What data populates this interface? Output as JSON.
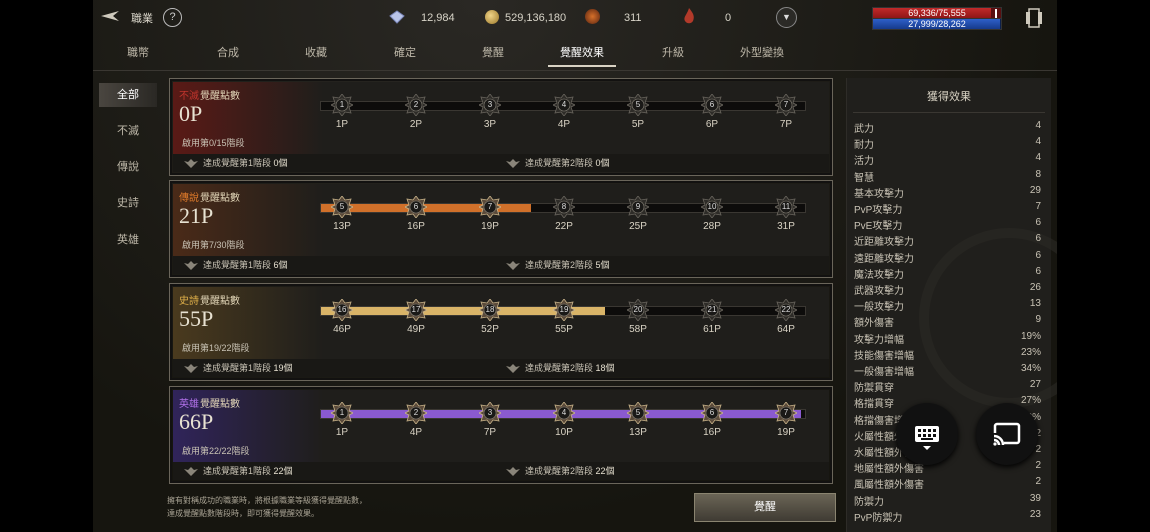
{
  "top": {
    "class_label": "職業",
    "gem": "12,984",
    "gold": "529,136,180",
    "gift": "311",
    "flame": "0",
    "hp": "69,336/75,555",
    "hp_fraction": 0.918,
    "mp": "27,999/28,262",
    "mp_fraction": 0.99
  },
  "tabs": [
    "職幣",
    "合成",
    "收藏",
    "確定",
    "覺醒",
    "覺醒效果",
    "升級",
    "外型變換"
  ],
  "active_tab": 5,
  "sidebar": [
    "全部",
    "不滅",
    "傳說",
    "史詩",
    "英雄"
  ],
  "active_side": 0,
  "panels": [
    {
      "rarity": "不滅",
      "title_suffix": "覺醒點數",
      "points": "0P",
      "sub_prefix": "啟用第",
      "sub_value": "0/15",
      "sub_suffix": "階段",
      "foot1_label": "達成覺醒第1階段",
      "foot1_value": "0個",
      "foot2_label": "達成覺醒第2階段",
      "foot2_value": "0個",
      "color": "#c0342c",
      "grad": "#5a1a16",
      "track_fill": "#000000",
      "filled": 0,
      "nodes": [
        "1",
        "2",
        "3",
        "4",
        "5",
        "6",
        "7"
      ],
      "labels": [
        "1P",
        "2P",
        "3P",
        "4P",
        "5P",
        "6P",
        "7P"
      ]
    },
    {
      "rarity": "傳說",
      "title_suffix": "覺醒點數",
      "points": "21P",
      "sub_prefix": "啟用第",
      "sub_value": "7/30",
      "sub_suffix": "階段",
      "foot1_label": "達成覺醒第1階段",
      "foot1_value": "6個",
      "foot2_label": "達成覺醒第2階段",
      "foot2_value": "5個",
      "color": "#e07b2a",
      "grad": "#4a2a18",
      "track_fill": "#d0702a",
      "filled": 3,
      "nodes": [
        "5",
        "6",
        "7",
        "8",
        "9",
        "10",
        "11"
      ],
      "labels": [
        "13P",
        "16P",
        "19P",
        "22P",
        "25P",
        "28P",
        "31P"
      ]
    },
    {
      "rarity": "史詩",
      "title_suffix": "覺醒點數",
      "points": "55P",
      "sub_prefix": "啟用第",
      "sub_value": "19/22",
      "sub_suffix": "階段",
      "foot1_label": "達成覺醒第1階段",
      "foot1_value": "19個",
      "foot2_label": "達成覺醒第2階段",
      "foot2_value": "18個",
      "color": "#e0b04a",
      "grad": "#4a3a1e",
      "track_fill": "#d9b468",
      "filled": 4,
      "nodes": [
        "16",
        "17",
        "18",
        "19",
        "20",
        "21",
        "22"
      ],
      "labels": [
        "46P",
        "49P",
        "52P",
        "55P",
        "58P",
        "61P",
        "64P"
      ]
    },
    {
      "rarity": "英雄",
      "title_suffix": "覺醒點數",
      "points": "66P",
      "sub_prefix": "啟用第",
      "sub_value": "22/22",
      "sub_suffix": "階段",
      "foot1_label": "達成覺醒第1階段",
      "foot1_value": "22個",
      "foot2_label": "達成覺醒第2階段",
      "foot2_value": "22個",
      "color": "#b070e8",
      "grad": "#30245a",
      "track_fill": "#8a5ad0",
      "filled": 7,
      "nodes": [
        "1",
        "2",
        "3",
        "4",
        "5",
        "6",
        "7"
      ],
      "labels": [
        "1P",
        "4P",
        "7P",
        "10P",
        "13P",
        "16P",
        "19P"
      ]
    }
  ],
  "effects": {
    "title": "獲得效果",
    "stats": [
      [
        "武力",
        "4"
      ],
      [
        "耐力",
        "4"
      ],
      [
        "活力",
        "4"
      ],
      [
        "智慧",
        "8"
      ],
      [
        "基本攻擊力",
        "29"
      ],
      [
        "PvP攻擊力",
        "7"
      ],
      [
        "PvE攻擊力",
        "6"
      ],
      [
        "近距離攻擊力",
        "6"
      ],
      [
        "遠距離攻擊力",
        "6"
      ],
      [
        "魔法攻擊力",
        "6"
      ],
      [
        "武器攻擊力",
        "26"
      ],
      [
        "一般攻擊力",
        "13"
      ],
      [
        "額外傷害",
        "9"
      ],
      [
        "攻擊力增幅",
        "19%"
      ],
      [
        "技能傷害增幅",
        "23%"
      ],
      [
        "一般傷害增幅",
        "34%"
      ],
      [
        "防禦貫穿",
        "27"
      ],
      [
        "格擋貫穿",
        "27%"
      ],
      [
        "格擋傷害增幅",
        "2%"
      ],
      [
        "火屬性額外傷害",
        "2"
      ],
      [
        "水屬性額外傷害",
        "2"
      ],
      [
        "地屬性額外傷害",
        "2"
      ],
      [
        "風屬性額外傷害",
        "2"
      ],
      [
        "防禦力",
        "39"
      ],
      [
        "PvP防禦力",
        "23"
      ]
    ]
  },
  "footer_note_1": "擁有對稱成功的職業時，將根據職業等級獲得覺醒點數，",
  "footer_note_2": "達成覺醒點數階段時，即可獲得覺醒效果。",
  "confirm_label": "覺醒"
}
